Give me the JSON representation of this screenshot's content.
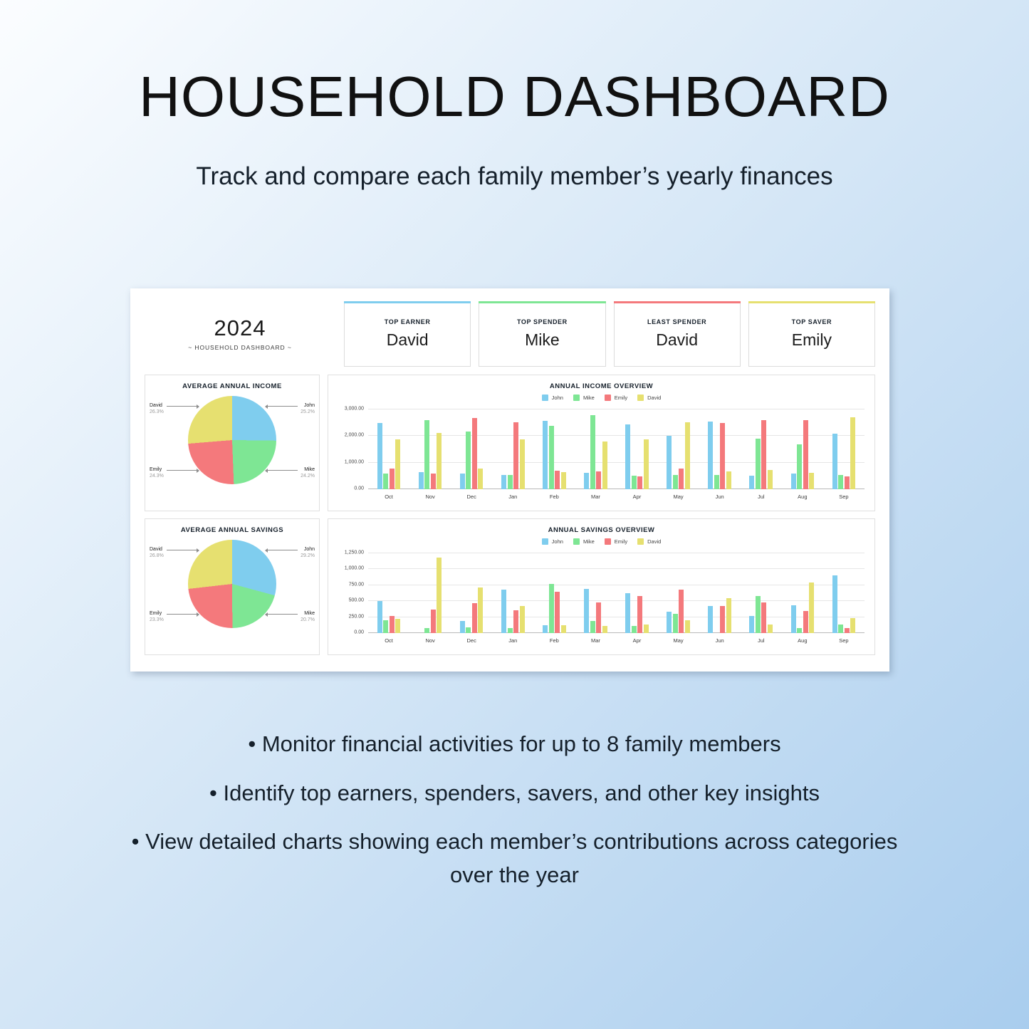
{
  "promo": {
    "title": "HOUSEHOLD DASHBOARD",
    "subtitle": "Track and compare each family member’s yearly finances",
    "bullets": [
      "• Monitor financial activities for up to 8 family members",
      "• Identify top earners, spenders, savers, and other key insights",
      "• View detailed charts showing each member’s contributions across categories over the year"
    ]
  },
  "dashboard": {
    "brand": {
      "year": "2024",
      "subtitle": "~ HOUSEHOLD DASHBOARD ~"
    },
    "kpis": [
      {
        "label": "TOP EARNER",
        "value": "David",
        "accent": "#7fcdee"
      },
      {
        "label": "TOP SPENDER",
        "value": "Mike",
        "accent": "#7ee694"
      },
      {
        "label": "LEAST SPENDER",
        "value": "David",
        "accent": "#f4797c"
      },
      {
        "label": "TOP SAVER",
        "value": "Emily",
        "accent": "#e6e070"
      }
    ],
    "members": [
      "John",
      "Mike",
      "Emily",
      "David"
    ],
    "colors": {
      "John": "#7fcdee",
      "Mike": "#7ee694",
      "Emily": "#f4797c",
      "David": "#e6e070"
    }
  },
  "chart_data": [
    {
      "id": "income-pie",
      "type": "pie",
      "title": "AVERAGE ANNUAL INCOME",
      "labels": [
        "John",
        "Mike",
        "Emily",
        "David"
      ],
      "values": [
        25.2,
        24.2,
        24.3,
        26.3
      ],
      "value_labels": [
        "25.2%",
        "24.2%",
        "24.3%",
        "26.3%"
      ],
      "colors": [
        "#7fcdee",
        "#7ee694",
        "#f4797c",
        "#e6e070"
      ],
      "legend": "callout-labels"
    },
    {
      "id": "savings-pie",
      "type": "pie",
      "title": "AVERAGE ANNUAL SAVINGS",
      "labels": [
        "John",
        "Mike",
        "Emily",
        "David"
      ],
      "values": [
        29.2,
        20.7,
        23.3,
        26.8
      ],
      "value_labels": [
        "29.2%",
        "20.7%",
        "23.3%",
        "26.8%"
      ],
      "colors": [
        "#7fcdee",
        "#7ee694",
        "#f4797c",
        "#e6e070"
      ],
      "legend": "callout-labels"
    },
    {
      "id": "income-bars",
      "type": "bar",
      "title": "ANNUAL INCOME OVERVIEW",
      "categories": [
        "Oct",
        "Nov",
        "Dec",
        "Jan",
        "Feb",
        "Mar",
        "Apr",
        "May",
        "Jun",
        "Jul",
        "Aug",
        "Sep"
      ],
      "ylim": [
        0,
        3000
      ],
      "yticks": [
        0,
        1000,
        2000,
        3000
      ],
      "ytick_labels": [
        "0.00",
        "1,000.00",
        "2,000.00",
        "3,000.00"
      ],
      "grid": true,
      "legend_position": "top",
      "xlabel": "",
      "ylabel": "",
      "series": [
        {
          "name": "John",
          "color": "#7fcdee",
          "values": [
            2490,
            650,
            590,
            545,
            2580,
            610,
            2430,
            2010,
            2540,
            500,
            600,
            2090
          ]
        },
        {
          "name": "Mike",
          "color": "#7ee694",
          "values": [
            590,
            2590,
            2180,
            525,
            2390,
            2790,
            505,
            540,
            545,
            1890,
            1690,
            540
          ]
        },
        {
          "name": "Emily",
          "color": "#f4797c",
          "values": [
            780,
            595,
            2690,
            2520,
            700,
            680,
            495,
            790,
            2490,
            2600,
            2600,
            490
          ]
        },
        {
          "name": "David",
          "color": "#e6e070",
          "values": [
            1880,
            2110,
            780,
            1880,
            640,
            1800,
            1880,
            2530,
            660,
            730,
            610,
            2710
          ]
        }
      ]
    },
    {
      "id": "savings-bars",
      "type": "bar",
      "title": "ANNUAL SAVINGS OVERVIEW",
      "categories": [
        "Oct",
        "Nov",
        "Dec",
        "Jan",
        "Feb",
        "Mar",
        "Apr",
        "May",
        "Jun",
        "Jul",
        "Aug",
        "Sep"
      ],
      "ylim": [
        0,
        1250
      ],
      "yticks": [
        0,
        250,
        500,
        750,
        1000,
        1250
      ],
      "ytick_labels": [
        "0.00",
        "250.00",
        "500.00",
        "750.00",
        "1,000.00",
        "1,250.00"
      ],
      "grid": true,
      "legend_position": "top",
      "xlabel": "",
      "ylabel": "",
      "series": [
        {
          "name": "John",
          "color": "#7fcdee",
          "values": [
            497,
            0,
            193,
            685,
            118,
            695,
            620,
            330,
            425,
            270,
            435,
            905
          ]
        },
        {
          "name": "Mike",
          "color": "#7ee694",
          "values": [
            196,
            80,
            88,
            78,
            765,
            195,
            115,
            300,
            0,
            580,
            75,
            130
          ]
        },
        {
          "name": "Emily",
          "color": "#f4797c",
          "values": [
            265,
            365,
            470,
            360,
            645,
            480,
            580,
            680,
            420,
            475,
            350,
            75
          ]
        },
        {
          "name": "David",
          "color": "#e6e070",
          "values": [
            225,
            1180,
            710,
            420,
            120,
            110,
            130,
            200,
            545,
            135,
            795,
            235
          ]
        }
      ]
    }
  ]
}
